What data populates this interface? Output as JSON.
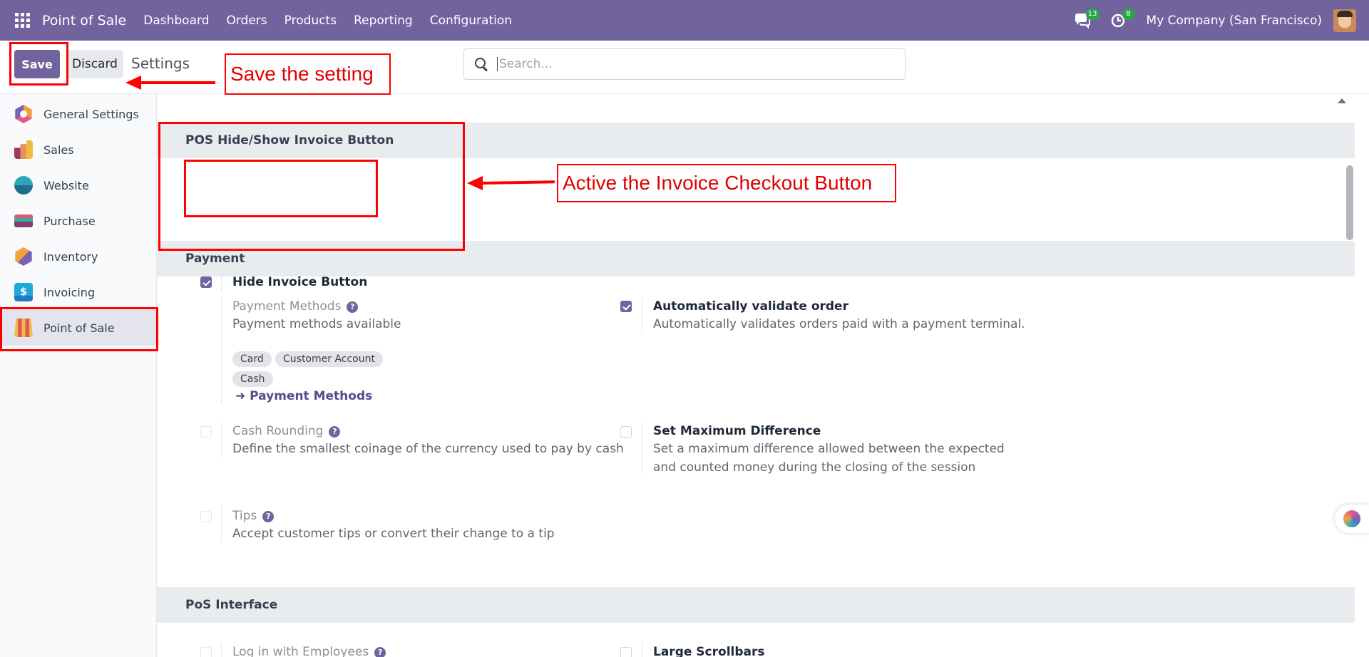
{
  "navbar": {
    "brand": "Point of Sale",
    "menu": [
      "Dashboard",
      "Orders",
      "Products",
      "Reporting",
      "Configuration"
    ],
    "messages_badge": "13",
    "activities_badge": "8",
    "company": "My Company (San Francisco)"
  },
  "control": {
    "save_label": "Save",
    "discard_label": "Discard",
    "title": "Settings",
    "search_placeholder": "Search..."
  },
  "sidebar": {
    "items": [
      {
        "label": "General Settings",
        "icon": "general-settings-icon"
      },
      {
        "label": "Sales",
        "icon": "sales-icon"
      },
      {
        "label": "Website",
        "icon": "website-icon"
      },
      {
        "label": "Purchase",
        "icon": "purchase-icon"
      },
      {
        "label": "Inventory",
        "icon": "inventory-icon"
      },
      {
        "label": "Invoicing",
        "icon": "invoicing-icon"
      },
      {
        "label": "Point of Sale",
        "icon": "point-of-sale-icon",
        "active": true
      }
    ],
    "invoicing_glyph": "$"
  },
  "sections": {
    "invoice": {
      "title": "POS Hide/Show Invoice Button",
      "hide_invoice_label": "Hide Invoice Button",
      "hide_invoice_checked": true
    },
    "payment": {
      "title": "Payment",
      "payment_methods_label": "Payment Methods",
      "payment_methods_desc": "Payment methods available",
      "tags": [
        "Card",
        "Customer Account",
        "Cash"
      ],
      "payment_methods_link": "Payment Methods",
      "auto_validate_label": "Automatically validate order",
      "auto_validate_desc": "Automatically validates orders paid with a payment terminal.",
      "auto_validate_checked": true,
      "cash_rounding_label": "Cash Rounding",
      "cash_rounding_desc": "Define the smallest coinage of the currency used to pay by cash",
      "max_diff_label": "Set Maximum Difference",
      "max_diff_desc": "Set a maximum difference allowed between the expected and counted money during the closing of the session",
      "tips_label": "Tips",
      "tips_desc": "Accept customer tips or convert their change to a tip"
    },
    "interface": {
      "title": "PoS Interface",
      "employees_label": "Log in with Employees",
      "scrollbars_label": "Large Scrollbars"
    }
  },
  "annotations": {
    "save_note": "Save the setting",
    "invoice_note": "Active the Invoice Checkout Button"
  },
  "colors": {
    "brand": "#71639e",
    "annotation": "#ff0000"
  }
}
